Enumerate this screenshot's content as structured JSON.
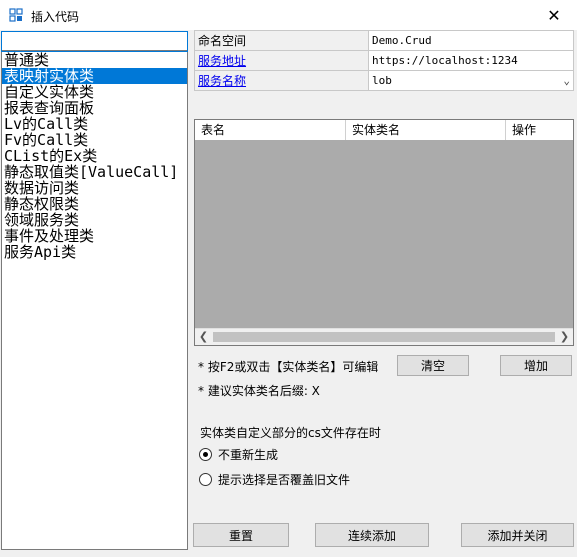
{
  "window": {
    "title": "插入代码",
    "close": "✕"
  },
  "search": {
    "value": ""
  },
  "categories": [
    "普通类",
    "表映射实体类",
    "自定义实体类",
    "报表查询面板",
    "Lv的Call类",
    "Fv的Call类",
    "CList的Ex类",
    "静态取值类[ValueCall]",
    "数据访问类",
    "静态权限类",
    "领域服务类",
    "事件及处理类",
    "服务Api类"
  ],
  "selected_index": 1,
  "props": {
    "namespace_label": "命名空间",
    "namespace_value": "Demo.Crud",
    "service_url_label": "服务地址",
    "service_url_value": "https://localhost:1234",
    "service_name_label": "服务名称",
    "service_name_value": "lob"
  },
  "table": {
    "headers": [
      "表名",
      "实体类名",
      "操作"
    ]
  },
  "hints": {
    "edit": "* 按F2或双击【实体类名】可编辑",
    "suffix": "* 建议实体类名后缀: X"
  },
  "buttons": {
    "clear": "清空",
    "add": "增加",
    "reset": "重置",
    "continuous_add": "连续添加",
    "add_close": "添加并关闭"
  },
  "options": {
    "heading": "实体类自定义部分的cs文件存在时",
    "opt1": "不重新生成",
    "opt2": "提示选择是否覆盖旧文件",
    "checked": "opt1"
  }
}
